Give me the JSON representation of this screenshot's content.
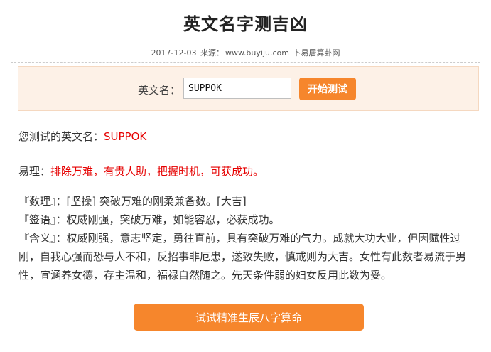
{
  "page": {
    "title": "英文名字测吉凶",
    "meta": {
      "date": "2017-12-03",
      "source_label": "来源：",
      "source_url": "www.buyiju.com",
      "source_name": "卜易居算卦网"
    }
  },
  "form": {
    "label": "英文名：",
    "input_value": "SUPPOK",
    "submit_label": "开始测试"
  },
  "result": {
    "name_label": "您测试的英文名：",
    "name_value": "SUPPOK",
    "yili_label": "易理：",
    "yili_value": "排除万难，有贵人助，把握时机，可获成功。",
    "shuli_label": "『数理』：",
    "shuli_value": "[坚操] 突破万难的刚柔兼备数。[大吉]",
    "qianyu_label": "『签语』：",
    "qianyu_value": "权威刚强，突破万难，如能容忍，必获成功。",
    "hanyi_label": "『含义』：",
    "hanyi_value": "权威刚强，意志坚定，勇往直前，具有突破万难的气力。成就大功大业，但因赋性过刚，自我心强而恐与人不和，反招事非厄患，遂致失败，慎戒则为大吉。女性有此数者易流于男性，宜涵养女德，存主温和，福禄自然随之。先天条件弱的妇女反用此数为妥。"
  },
  "cta": {
    "label": "试试精准生辰八字算命"
  },
  "colors": {
    "accent": "#f6862c",
    "highlight_red": "#e60000",
    "form_bg": "#fdf1e7"
  }
}
